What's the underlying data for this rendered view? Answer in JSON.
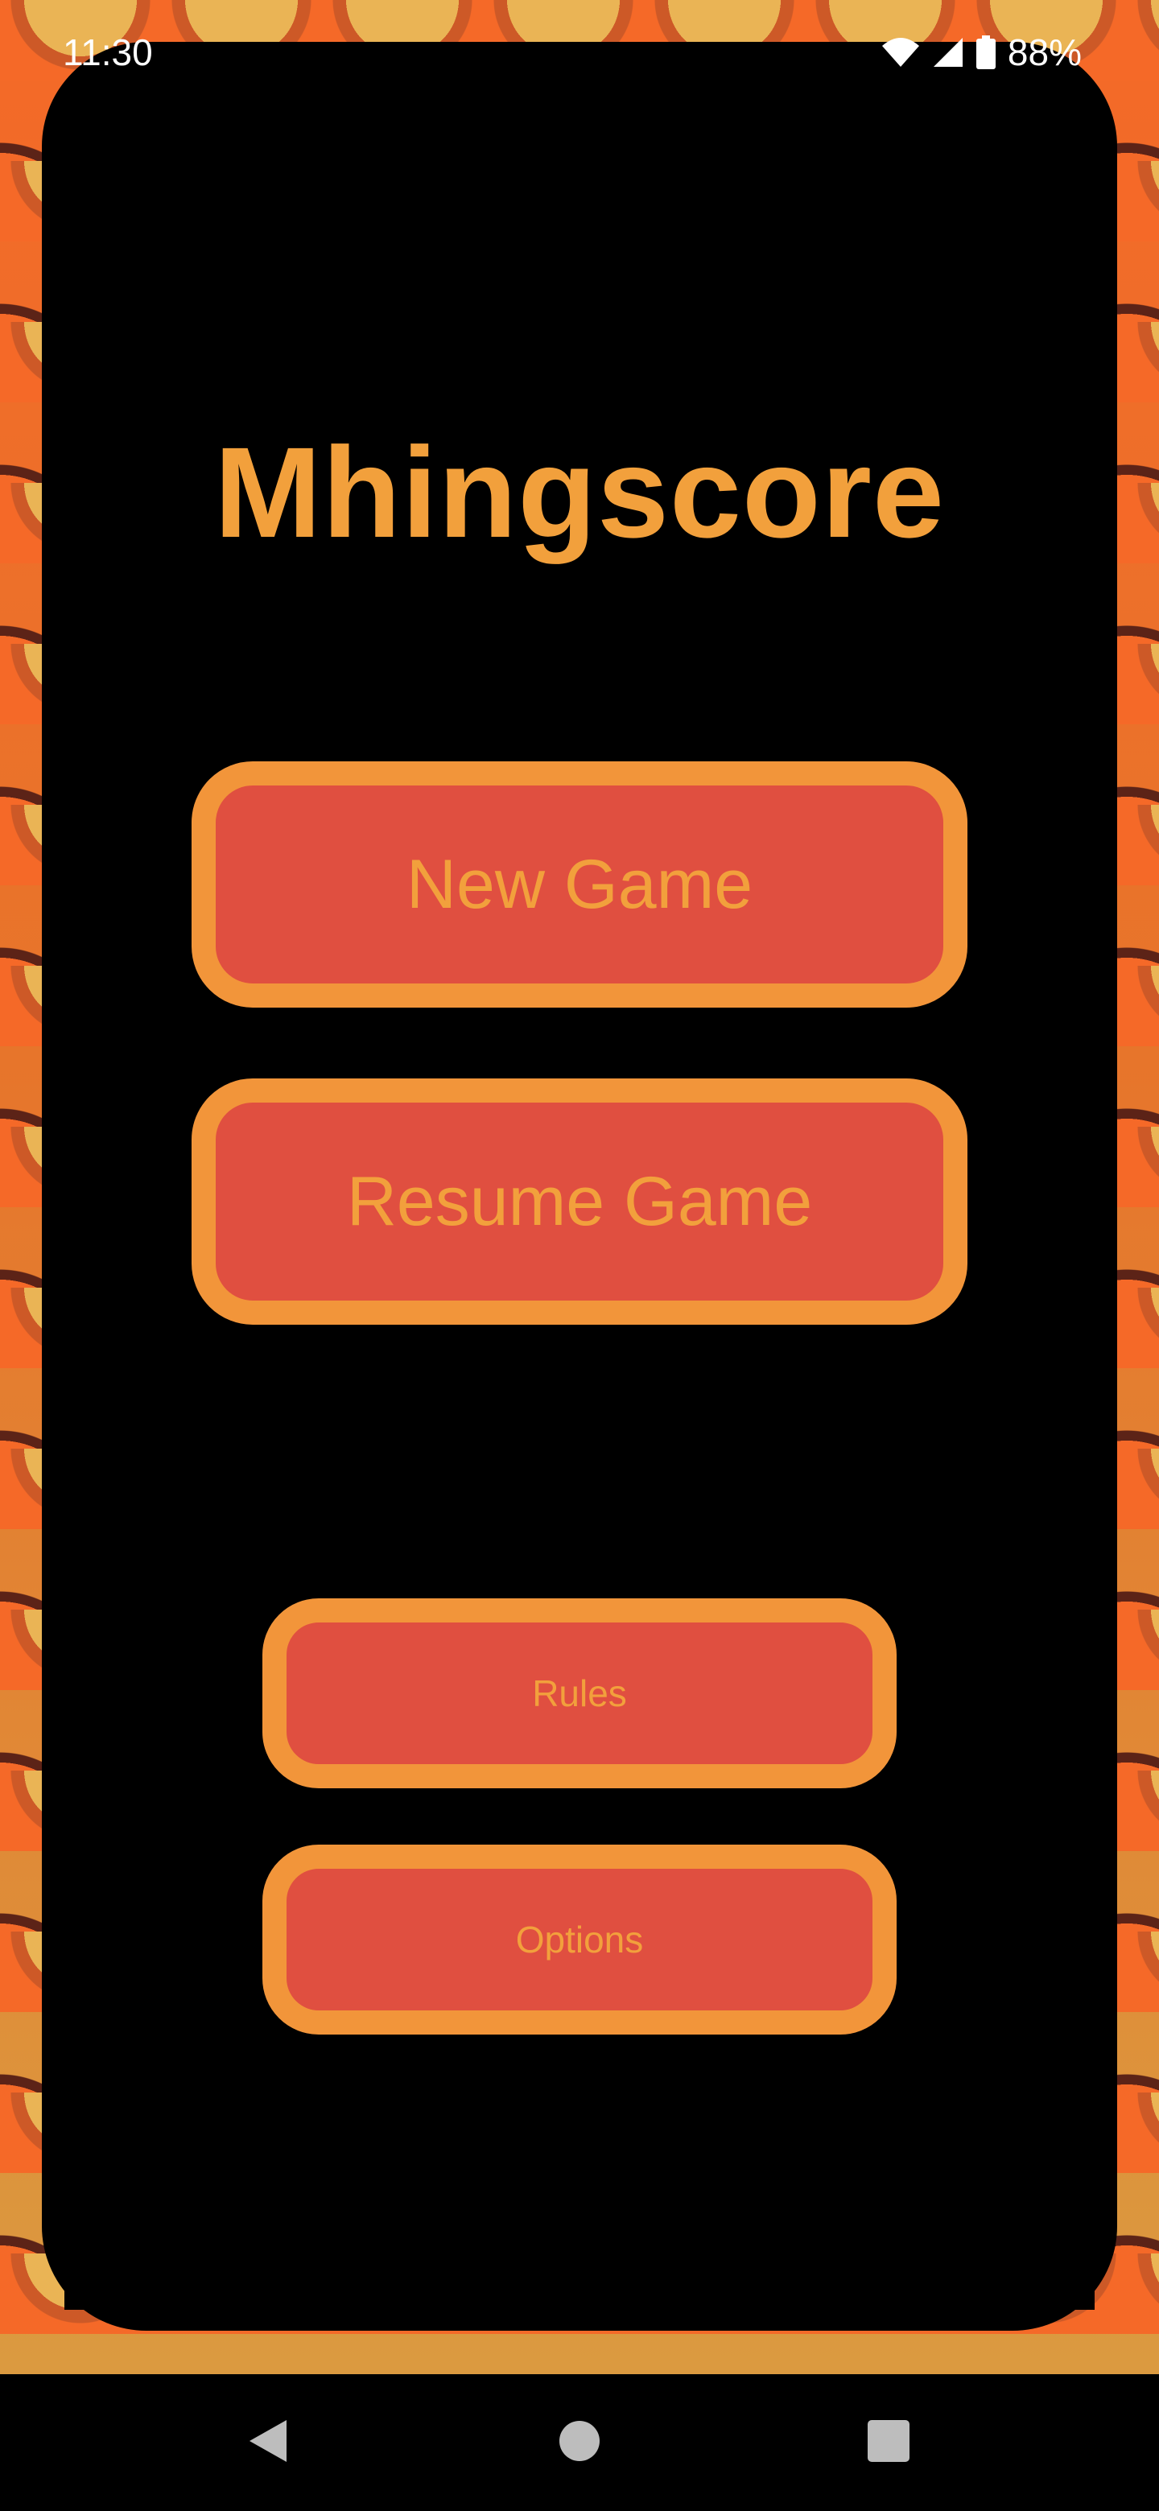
{
  "status_bar": {
    "time": "11:30",
    "battery_text": "88%",
    "battery_level": 0.88,
    "icons": [
      "wifi-icon",
      "signal-icon",
      "battery-icon"
    ]
  },
  "app": {
    "title": "Mhingscore"
  },
  "menu": {
    "new_game_label": "New Game",
    "resume_game_label": "Resume Game",
    "rules_label": "Rules",
    "options_label": "Options"
  },
  "nav_bar": {
    "icons": [
      "back-icon",
      "home-icon",
      "recents-icon"
    ]
  },
  "colors": {
    "title_text": "#f2a03c",
    "button_fill": "#e04f40",
    "button_border": "#f2953a",
    "card_background": "#000000"
  }
}
